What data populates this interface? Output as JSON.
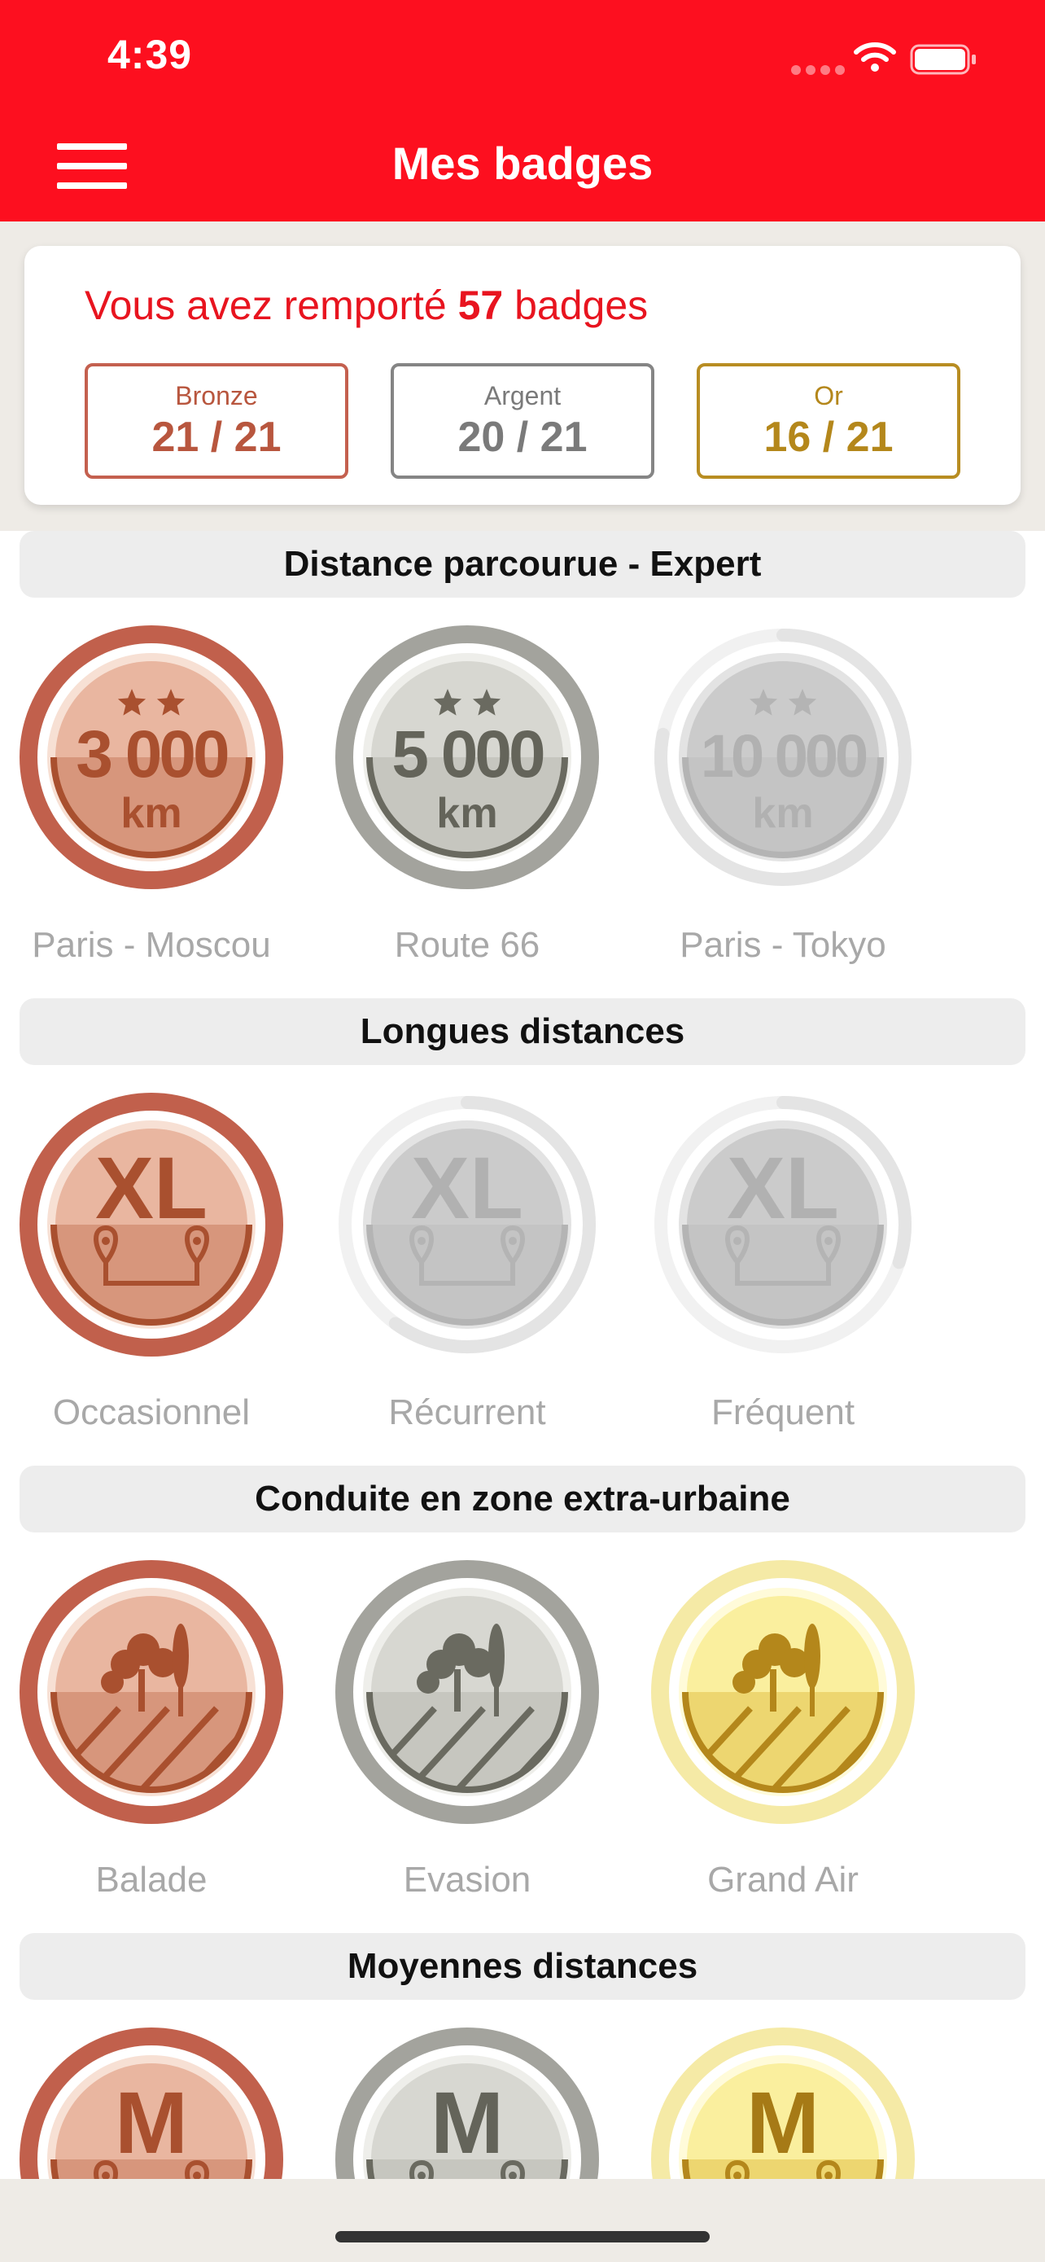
{
  "status_bar": {
    "time": "4:39"
  },
  "header": {
    "title": "Mes badges"
  },
  "summary": {
    "prefix": "Vous avez remporté",
    "count": "57",
    "suffix": "badges",
    "bronze": {
      "label": "Bronze",
      "value": "21 / 21"
    },
    "argent": {
      "label": "Argent",
      "value": "20 / 21"
    },
    "or": {
      "label": "Or",
      "value": "16 / 21"
    }
  },
  "sections": [
    {
      "title": "Distance parcourue - Expert",
      "badges": [
        {
          "label": "Paris - Moscou",
          "tier": "bronze",
          "icon": "distance-3000-icon",
          "value": "3 000",
          "unit": "km",
          "progress": 1.0
        },
        {
          "label": "Route 66",
          "tier": "silver",
          "icon": "distance-5000-icon",
          "value": "5 000",
          "unit": "km",
          "progress": 1.0
        },
        {
          "label": "Paris - Tokyo",
          "tier": "locked",
          "icon": "distance-10000-icon",
          "value": "10 000",
          "unit": "km",
          "progress": 0.78
        }
      ]
    },
    {
      "title": "Longues distances",
      "badges": [
        {
          "label": "Occasionnel",
          "tier": "bronze",
          "icon": "xl-route-icon",
          "value": "XL",
          "progress": 1.0
        },
        {
          "label": "Récurrent",
          "tier": "locked",
          "icon": "xl-route-icon",
          "value": "XL",
          "progress": 0.6
        },
        {
          "label": "Fréquent",
          "tier": "locked",
          "icon": "xl-route-icon",
          "value": "XL",
          "progress": 0.3
        }
      ]
    },
    {
      "title": "Conduite en zone extra-urbaine",
      "badges": [
        {
          "label": "Balade",
          "tier": "bronze",
          "icon": "countryside-icon",
          "progress": 1.0
        },
        {
          "label": "Evasion",
          "tier": "silver",
          "icon": "countryside-icon",
          "progress": 1.0
        },
        {
          "label": "Grand Air",
          "tier": "gold",
          "icon": "countryside-icon",
          "progress": 1.0
        }
      ]
    },
    {
      "title": "Moyennes distances",
      "badges": [
        {
          "label": "",
          "tier": "bronze",
          "icon": "m-route-icon",
          "value": "M",
          "progress": 1.0
        },
        {
          "label": "",
          "tier": "silver",
          "icon": "m-route-icon",
          "value": "M",
          "progress": 1.0
        },
        {
          "label": "",
          "tier": "gold",
          "icon": "m-route-icon",
          "value": "M",
          "progress": 1.0
        }
      ]
    }
  ],
  "colors": {
    "header": "#fd0f1f",
    "bronze": "#c1604c",
    "silver": "#a3a39d",
    "gold": "#b4871b",
    "locked": "#e9e9e9"
  }
}
